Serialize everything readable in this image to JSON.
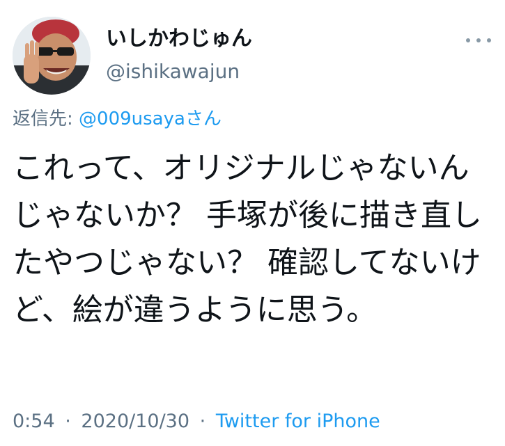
{
  "tweet": {
    "author": {
      "display_name": "いしかわじゅん",
      "handle": "@ishikawajun"
    },
    "reply_to": {
      "prefix": "返信先:",
      "mention": "@009usaya",
      "suffix": "さん"
    },
    "text": "これって、オリジナルじゃないんじゃないか？ 手塚が後に描き直したやつじゃない？ 確認してないけど、絵が違うように思う。",
    "time": "0:54",
    "separator": "·",
    "date": "2020/10/30",
    "source": "Twitter for iPhone"
  },
  "icons": {
    "more": "more-horizontal-icon"
  },
  "colors": {
    "text": "#0f1419",
    "secondary": "#5b7083",
    "link": "#1d9bf0"
  }
}
